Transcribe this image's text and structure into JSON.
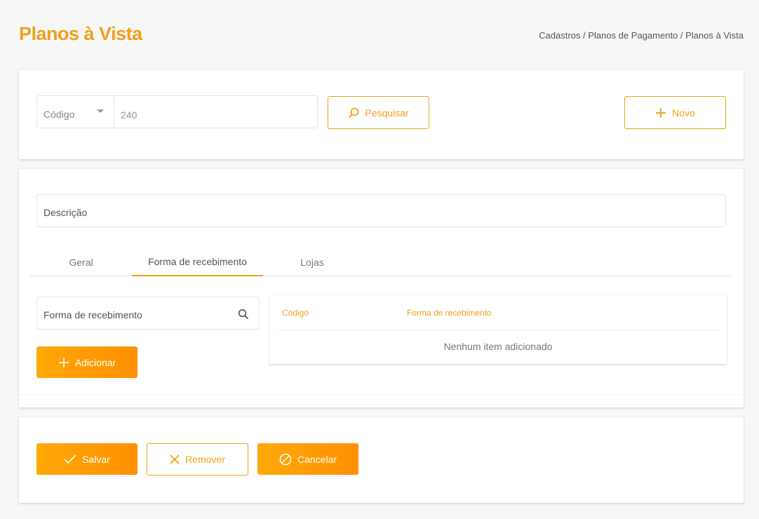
{
  "header": {
    "title": "Planos à Vista",
    "breadcrumb": "Cadastros / Planos de Pagamento / Planos à Vista"
  },
  "search": {
    "field_select": "Código",
    "value": "240",
    "search_button": "Pesquisar",
    "new_button": "Novo"
  },
  "form": {
    "description_placeholder": "Descrição",
    "tabs": [
      {
        "label": "Geral",
        "active": false
      },
      {
        "label": "Forma de recebimento",
        "active": true
      },
      {
        "label": "Lojas",
        "active": false
      }
    ],
    "forma_input_placeholder": "Forma de recebimento",
    "add_button": "Adicionar",
    "table": {
      "columns": [
        "Código",
        "Forma de recebimento"
      ],
      "empty_message": "Nenhum item adicionado"
    }
  },
  "actions": {
    "save": "Salvar",
    "remove": "Remover",
    "cancel": "Cancelar"
  },
  "colors": {
    "accent": "#f0a01a",
    "button_gradient_start": "#ffa908",
    "button_gradient_end": "#ff8f00"
  },
  "icons": [
    "magnifier-icon",
    "plus-icon",
    "search-icon",
    "check-icon",
    "x-icon",
    "ban-icon",
    "caret-down-icon"
  ]
}
